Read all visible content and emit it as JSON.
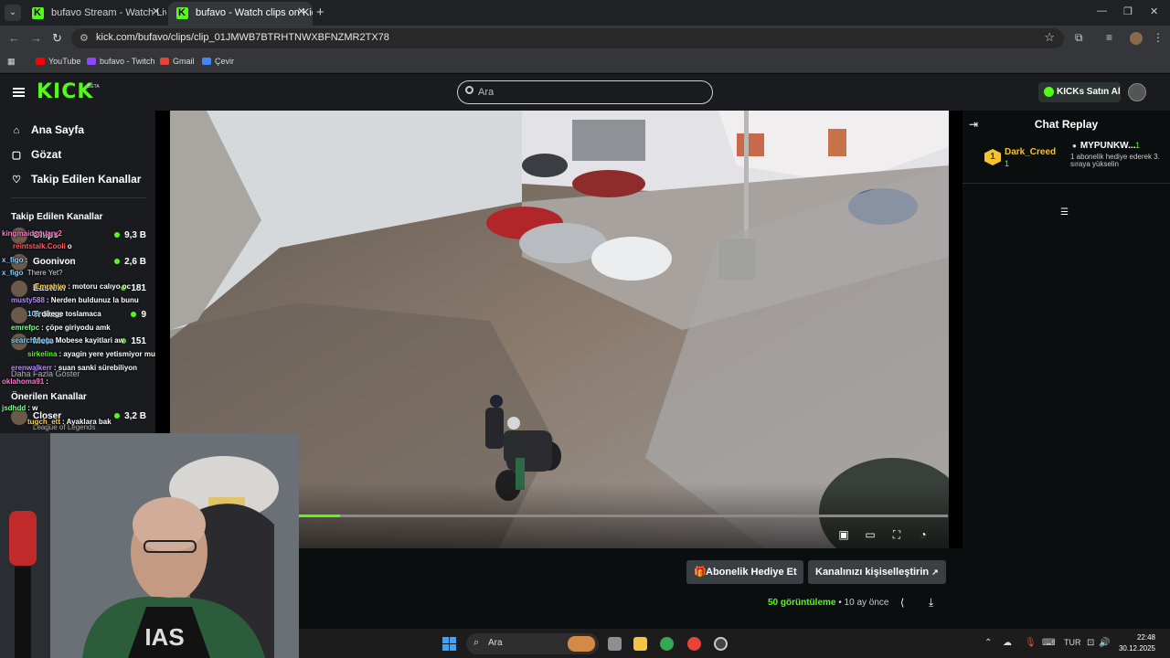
{
  "browser": {
    "tabs": [
      {
        "title": "bufavo Stream - Watch Live on",
        "active": false
      },
      {
        "title": "bufavo - Watch clips on Kick",
        "active": true
      }
    ],
    "url": "kick.com/bufavo/clips/clip_01JMWB7BTRHTNWXBFNZMR2TX78",
    "bookmarks": [
      "YouTube",
      "bufavo - Twitch",
      "Gmail",
      "Çevir"
    ]
  },
  "kick": {
    "logo": "KICK",
    "beta": "BETA",
    "search_placeholder": "Ara",
    "kicks_button": "KICKs Satın Al"
  },
  "sidebar": {
    "nav": [
      {
        "label": "Ana Sayfa",
        "icon": "home-icon"
      },
      {
        "label": "Gözat",
        "icon": "browse-icon"
      },
      {
        "label": "Takip Edilen Kanallar",
        "icon": "heart-icon"
      }
    ],
    "followed_heading": "Takip Edilen Kanallar",
    "followed": [
      {
        "name": "Chips",
        "viewers": "9,3 B"
      },
      {
        "name": "Goonivon",
        "viewers": "2,6 B"
      },
      {
        "name": "Eastein",
        "viewers": "181"
      },
      {
        "name": "Trokss",
        "viewers": "9"
      },
      {
        "name": "Mete",
        "viewers": "151"
      }
    ],
    "show_more": "Daha Fazla Göster",
    "recommended_heading": "Önerilen Kanallar",
    "recommended": [
      {
        "name": "Closer",
        "viewers": "3,2 B",
        "game": "League of Legends"
      }
    ]
  },
  "overlay_chat": [
    {
      "user": "kingmaidsquary2",
      "msg": "",
      "color": "#ff7acb"
    },
    {
      "user": "reintstalk.Cooli",
      "msg": "o",
      "color": "#ff5c5c"
    },
    {
      "user": "x_figo",
      "msg": ":",
      "color": "#7fd3ff"
    },
    {
      "user": "x_figo",
      "msg": "There Yet?",
      "color": "#7fd3ff"
    },
    {
      "user": "Emrahyo",
      "msg": ": motoru calıyo oc",
      "color": "#ffd24d"
    },
    {
      "user": "musty588",
      "msg": ": Nerden buldunuz la bunu",
      "color": "#b98cff"
    },
    {
      "user": "10s",
      "msg": "direge toslamaca",
      "color": "#7fd3ff"
    },
    {
      "user": "emrefpc",
      "msg": ": çöpe giriyodu amk",
      "color": "#7dff8f"
    },
    {
      "user": "searchmega",
      "msg": "Mobese kayitlari aw",
      "color": "#7fd3ff"
    },
    {
      "user": "sirkelina",
      "msg": ": ayagin yere yetismiyor mu",
      "color": "#53fc18"
    },
    {
      "user": "erenwalkerr",
      "msg": ": suan sanki sürebiliyon",
      "color": "#b98cff"
    },
    {
      "user": "oklahoma91",
      "msg": ":",
      "color": "#ff7acb"
    },
    {
      "user": "jsdhdd",
      "msg": ": w",
      "color": "#7dff8f"
    },
    {
      "user": "tugch_ett",
      "msg": ": Ayaklara bak",
      "color": "#ffd24d"
    }
  ],
  "player": {
    "progress": 0.063
  },
  "chat_replay": {
    "title": "Chat Replay",
    "top_gifter": {
      "rank": "1",
      "name": "Dark_Creed",
      "count": "1"
    },
    "second": {
      "name": "MYPUNKW...",
      "count": "1",
      "desc": "1 abonelik hediye ederek 3. sıraya yükselin"
    }
  },
  "below_video": {
    "gift_button": "Abonelik Hediye Et",
    "customize_button": "Kanalınızı kişiselleştirin",
    "views_count": "50",
    "views_label": "görüntüleme",
    "separator": "•",
    "age": "10 ay önce"
  },
  "taskbar": {
    "search": "Ara",
    "lang": "TUR",
    "time": "22:48",
    "date": "30.12.2025"
  },
  "colors": {
    "accent": "#53fc18",
    "bg": "#0b0e0f",
    "header": "#191b1f"
  }
}
